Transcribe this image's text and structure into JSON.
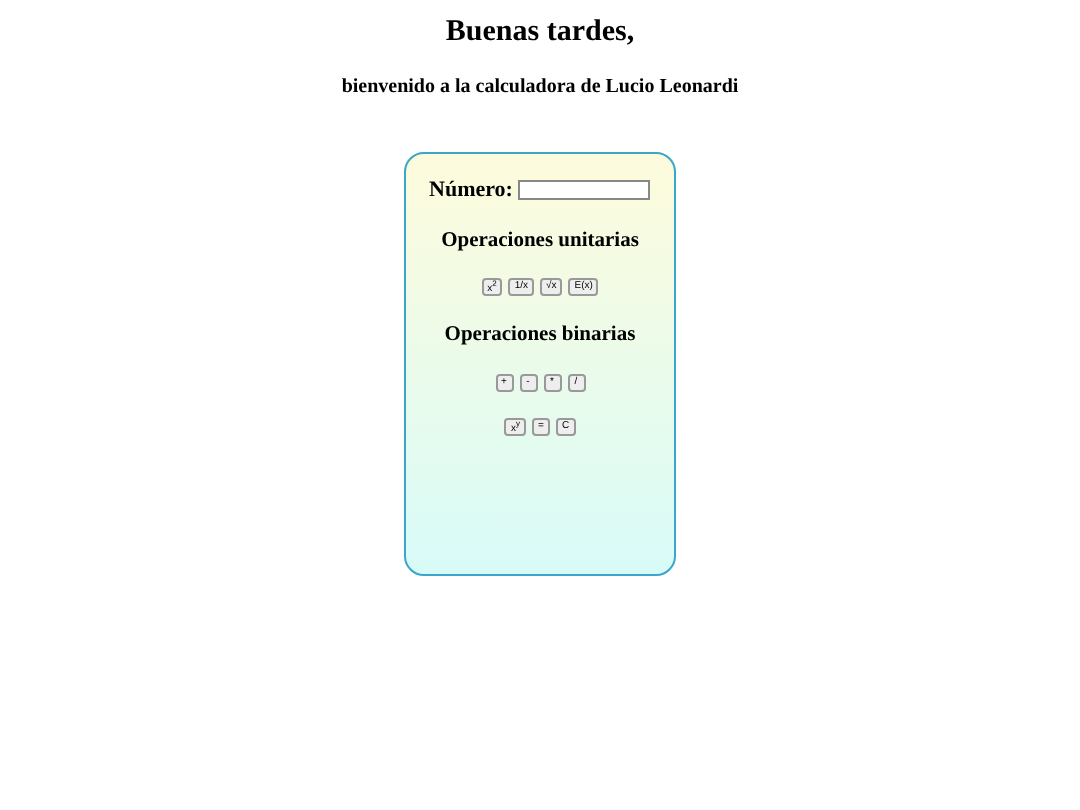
{
  "heading": "Buenas tardes,",
  "subheading": "bienvenido a la calculadora de Lucio Leonardi",
  "number_field": {
    "label": "Número:"
  },
  "unary": {
    "title": "Operaciones unitarias",
    "buttons": [
      "x$^{2}$",
      "1/x",
      "√x",
      "E(x)"
    ]
  },
  "binary": {
    "title": "Operaciones binarias",
    "rows": [
      [
        "+",
        "-",
        "*",
        "/"
      ],
      [
        "x$^{y}$",
        "=",
        "C"
      ]
    ]
  }
}
